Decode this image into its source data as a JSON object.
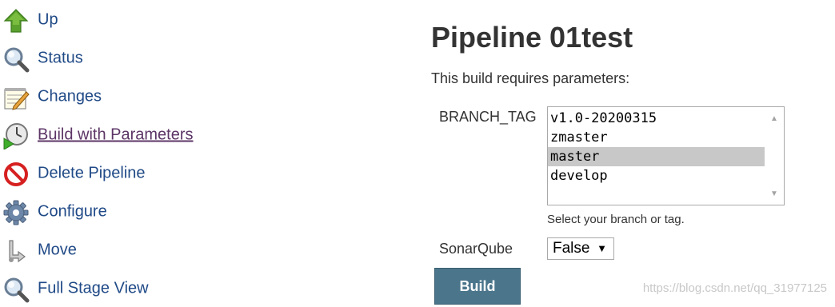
{
  "sidebar": {
    "items": [
      {
        "label": "Up",
        "icon": "up-arrow-icon"
      },
      {
        "label": "Status",
        "icon": "magnifier-icon"
      },
      {
        "label": "Changes",
        "icon": "notepad-icon"
      },
      {
        "label": "Build with Parameters",
        "icon": "clock-play-icon"
      },
      {
        "label": "Delete Pipeline",
        "icon": "no-entry-icon"
      },
      {
        "label": "Configure",
        "icon": "gear-icon"
      },
      {
        "label": "Move",
        "icon": "move-icon"
      },
      {
        "label": "Full Stage View",
        "icon": "magnifier-icon"
      }
    ]
  },
  "main": {
    "title": "Pipeline 01test",
    "intro": "This build requires parameters:",
    "parameters": {
      "branch_tag": {
        "name": "BRANCH_TAG",
        "options": [
          "v1.0-20200315",
          "zmaster",
          "master",
          "develop"
        ],
        "selected": "master",
        "description": "Select your branch or tag."
      },
      "sonarqube": {
        "name": "SonarQube",
        "value": "False"
      }
    },
    "build_label": "Build"
  },
  "watermark": "https://blog.csdn.net/qq_31977125",
  "colors": {
    "link": "#204A87",
    "visited_link": "#5c3566",
    "build_button": "#4b758b",
    "selected_option": "#c8c8c8"
  }
}
